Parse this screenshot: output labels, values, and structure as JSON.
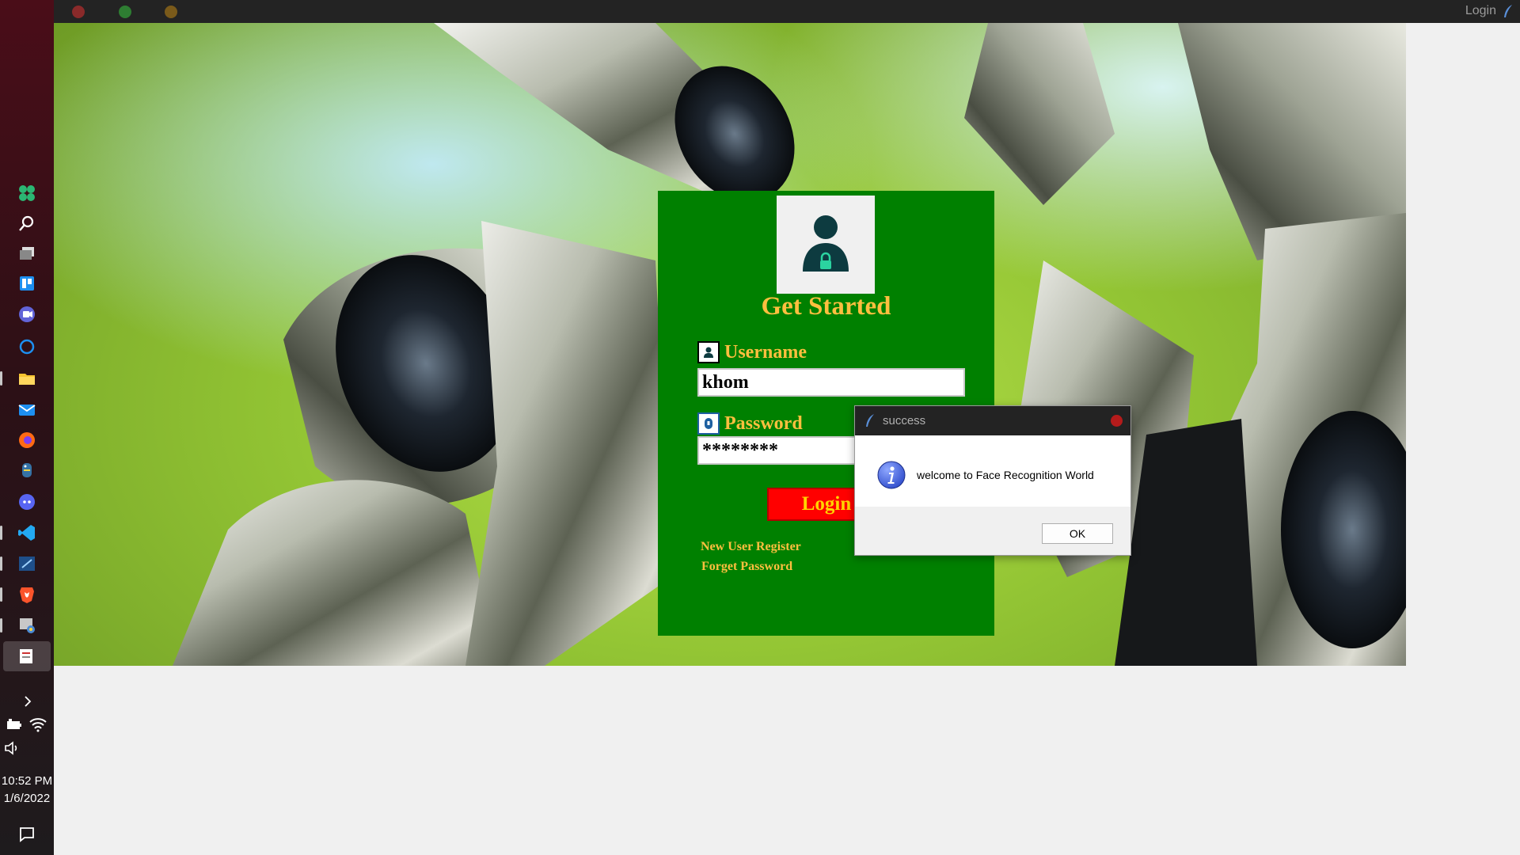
{
  "window": {
    "title": "Login",
    "traffic_lights": [
      "#8a2a2a",
      "#2e7d32",
      "#7a5a1a"
    ]
  },
  "login": {
    "heading": "Get Started",
    "username_label": "Username",
    "username_value": "khom",
    "password_label": "Password",
    "password_value": "********",
    "login_button": "Login",
    "register_link": "New User Register",
    "forgot_link": "Forget Password",
    "card_color": "#008000",
    "text_color": "#ffbf3f",
    "button_color": "#ff0000"
  },
  "dialog": {
    "title": "success",
    "message": "welcome to Face Recognition World",
    "ok_button": "OK"
  },
  "taskbar": {
    "icons": [
      "apps-icon",
      "search-icon",
      "task-view-icon",
      "widgets-icon",
      "chat-icon",
      "cortana-icon",
      "file-explorer-icon",
      "mail-icon",
      "firefox-icon",
      "python-icon",
      "discord-icon",
      "vscode-icon",
      "terminal-icon",
      "brave-icon",
      "app-icon",
      "login-app-icon"
    ],
    "time": "10:52 PM",
    "date": "1/6/2022"
  }
}
